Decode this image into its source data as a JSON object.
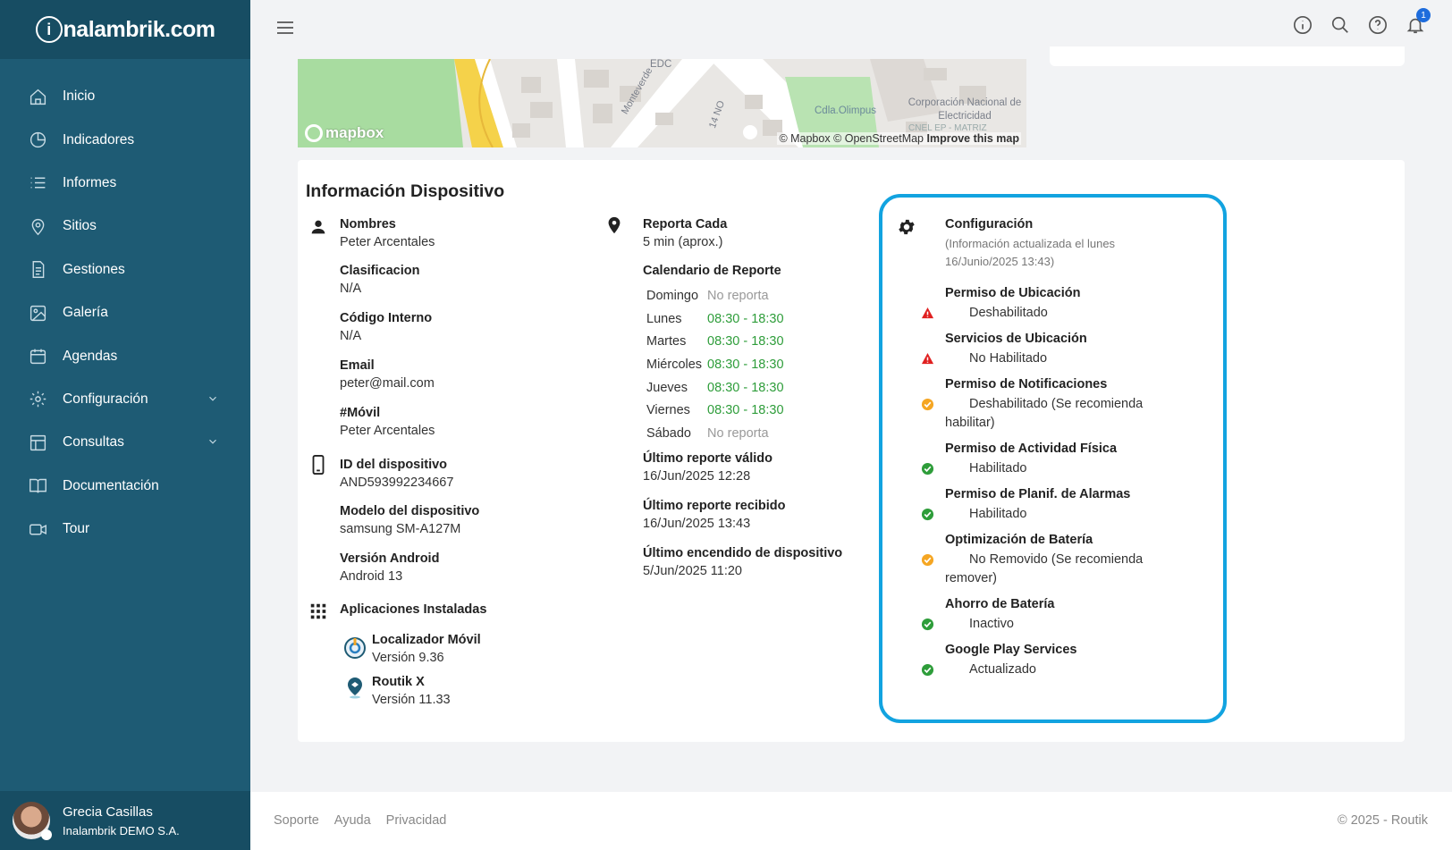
{
  "brand": {
    "logo_text": "nalambrik.com",
    "logo_letter": "i"
  },
  "sidebar": {
    "items": [
      {
        "label": "Inicio",
        "icon": "home-icon"
      },
      {
        "label": "Indicadores",
        "icon": "pie-chart-icon"
      },
      {
        "label": "Informes",
        "icon": "list-icon"
      },
      {
        "label": "Sitios",
        "icon": "location-pin-icon"
      },
      {
        "label": "Gestiones",
        "icon": "document-icon"
      },
      {
        "label": "Galería",
        "icon": "image-icon"
      },
      {
        "label": "Agendas",
        "icon": "calendar-icon"
      },
      {
        "label": "Configuración",
        "icon": "gear-icon",
        "expandable": true
      },
      {
        "label": "Consultas",
        "icon": "table-icon",
        "expandable": true
      },
      {
        "label": "Documentación",
        "icon": "book-icon"
      },
      {
        "label": "Tour",
        "icon": "video-icon"
      }
    ],
    "user": {
      "name": "Grecia Casillas",
      "company": "Inalambrik DEMO S.A."
    }
  },
  "topbar": {
    "notification_count": "1"
  },
  "map": {
    "labels": {
      "edc": "EDC",
      "street": "Monteverde",
      "street2": "14 NO",
      "place": "Cdla.Olimpus",
      "corp": "Corporación Nacional de Electricidad",
      "cnel": "CNEL EP - MATRIZ"
    },
    "logo": "mapbox",
    "attribution_mapbox": "© Mapbox",
    "attribution_osm": "© OpenStreetMap",
    "attribution_improve": "Improve this map"
  },
  "device": {
    "title": "Información Dispositivo",
    "nombres": {
      "label": "Nombres",
      "value": "Peter Arcentales"
    },
    "clasificacion": {
      "label": "Clasificacion",
      "value": "N/A"
    },
    "codigo": {
      "label": "Código Interno",
      "value": "N/A"
    },
    "email": {
      "label": "Email",
      "value": "peter@mail.com"
    },
    "movil": {
      "label": "#Móvil",
      "value": "Peter Arcentales"
    },
    "device_id": {
      "label": "ID del dispositivo",
      "value": "AND593992234667"
    },
    "modelo": {
      "label": "Modelo del dispositivo",
      "value": "samsung SM-A127M"
    },
    "android": {
      "label": "Versión Android",
      "value": "Android 13"
    },
    "apps": {
      "label": "Aplicaciones Instaladas",
      "items": [
        {
          "name": "Localizador Móvil",
          "version": "Versión 9.36"
        },
        {
          "name": "Routik X",
          "version": "Versión 11.33"
        }
      ]
    },
    "reporta": {
      "label": "Reporta Cada",
      "value": "5 min (aprox.)"
    },
    "calendario": {
      "label": "Calendario de Reporte",
      "rows": [
        {
          "day": "Domingo",
          "hours": "No reporta"
        },
        {
          "day": "Lunes",
          "hours": "08:30 - 18:30"
        },
        {
          "day": "Martes",
          "hours": "08:30 - 18:30"
        },
        {
          "day": "Miércoles",
          "hours": "08:30 - 18:30"
        },
        {
          "day": "Jueves",
          "hours": "08:30 - 18:30"
        },
        {
          "day": "Viernes",
          "hours": "08:30 - 18:30"
        },
        {
          "day": "Sábado",
          "hours": "No reporta"
        }
      ]
    },
    "ultimo_valido": {
      "label": "Último reporte válido",
      "value": "16/Jun/2025 12:28"
    },
    "ultimo_recibido": {
      "label": "Último reporte recibido",
      "value": "16/Jun/2025 13:43"
    },
    "ultimo_encendido": {
      "label": "Último encendido de dispositivo",
      "value": "5/Jun/2025 11:20"
    }
  },
  "config": {
    "title": "Configuración",
    "subtitle": "(Información actualizada el lunes 16/Junio/2025 13:43)",
    "items": [
      {
        "label": "Permiso de Ubicación",
        "value": "Deshabilitado",
        "status": "error"
      },
      {
        "label": "Servicios de Ubicación",
        "value": "No Habilitado",
        "status": "error"
      },
      {
        "label": "Permiso de Notificaciones",
        "value": "Deshabilitado (Se recomienda habilitar)",
        "status": "warning"
      },
      {
        "label": "Permiso de Actividad Física",
        "value": "Habilitado",
        "status": "ok"
      },
      {
        "label": "Permiso de Planif. de Alarmas",
        "value": "Habilitado",
        "status": "ok"
      },
      {
        "label": "Optimización de Batería",
        "value": "No Removido (Se recomienda remover)",
        "status": "warning"
      },
      {
        "label": "Ahorro de Batería",
        "value": "Inactivo",
        "status": "ok"
      },
      {
        "label": "Google Play Services",
        "value": "Actualizado",
        "status": "ok"
      }
    ],
    "colors": {
      "border": "#12a3e0",
      "ok": "#2e9d3a",
      "warning": "#f5a623",
      "error": "#e02020"
    }
  },
  "footer": {
    "links": [
      "Soporte",
      "Ayuda",
      "Privacidad"
    ],
    "copyright": "© 2025 - Routik"
  }
}
